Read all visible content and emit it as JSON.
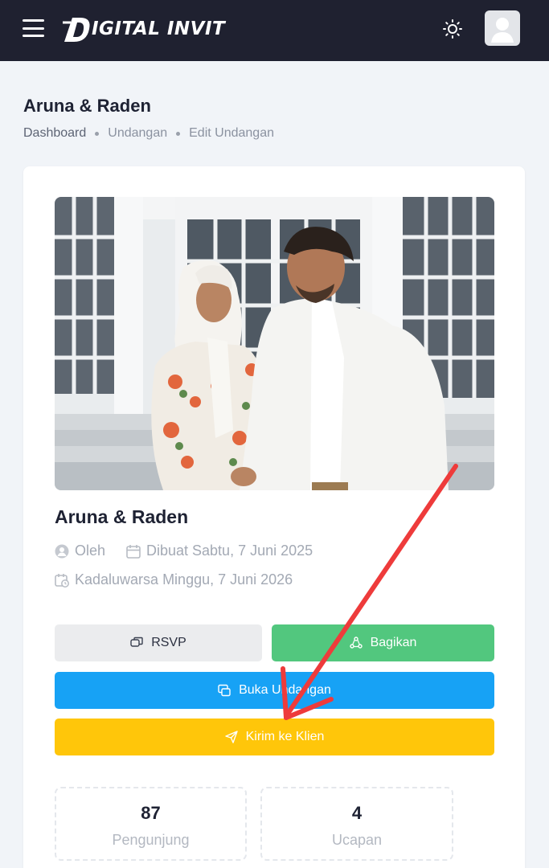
{
  "header": {
    "menu_icon": "hamburger-menu-icon",
    "logo_text": "IGITAL INVIT",
    "logo_monogram": "D",
    "theme_icon": "sun-icon",
    "avatar_icon": "user-avatar-icon",
    "colors": {
      "bar": "#1f2130"
    }
  },
  "page": {
    "title": "Aruna & Raden",
    "breadcrumb": [
      "Dashboard",
      "Undangan",
      "Edit Undangan"
    ]
  },
  "invitation": {
    "title": "Aruna & Raden",
    "photo": "couple-photo",
    "author_label": "Oleh",
    "created": "Dibuat Sabtu, 7 Juni 2025",
    "expires": "Kadaluwarsa Minggu, 7 Juni 2026"
  },
  "actions": {
    "rsvp": "RSVP",
    "share": "Bagikan",
    "open": "Buka Undangan",
    "send": "Kirim ke Klien",
    "colors": {
      "rsvp": "#ebecee",
      "share": "#52c77e",
      "open": "#17a2f5",
      "send": "#ffc60a",
      "annotation_arrow": "#ee3b3b"
    }
  },
  "stats": {
    "visitors": {
      "value": "87",
      "label": "Pengunjung"
    },
    "wishes": {
      "value": "4",
      "label": "Ucapan"
    }
  }
}
